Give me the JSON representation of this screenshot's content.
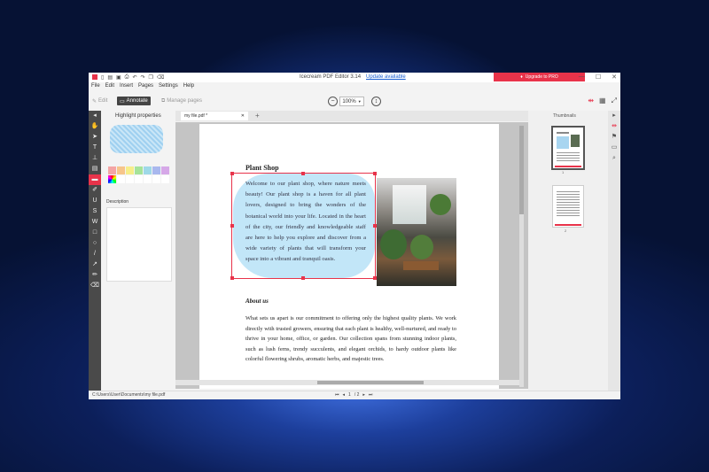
{
  "window": {
    "title": "Icecream PDF Editor 3.14",
    "update_link": "Update available",
    "upgrade_button": "Upgrade to PRO",
    "controls": [
      "—",
      "☐",
      "✕"
    ]
  },
  "menu": [
    "File",
    "Edit",
    "Insert",
    "Pages",
    "Settings",
    "Help"
  ],
  "toolbar": {
    "modes": [
      "Edit",
      "Annotate",
      "Manage pages"
    ],
    "active_mode": "Annotate",
    "zoom": "100%"
  },
  "props_panel": {
    "title": "Highlight properties",
    "description_label": "Description",
    "colors": [
      "#f4a5a5",
      "#f7c58a",
      "#f6ee8a",
      "#a6e39a",
      "#9fd9e8",
      "#a9b8ee",
      "#d6a8e8",
      "#ffffff"
    ]
  },
  "tabs": [
    {
      "label": "my file.pdf *"
    }
  ],
  "document": {
    "heading": "Plant Shop",
    "paragraph1": "Welcome to our plant shop, where nature meets beauty! Our plant shop is a haven for all plant lovers, designed to bring the wonders of the botanical world into your life. Located in the heart of the city, our friendly and knowledgeable staff are here to help you explore and discover from a wide variety of plants that will transform your space into a vibrant and tranquil oasis.",
    "subheading": "About us",
    "paragraph2": "What sets us apart is our commitment to offering only the highest quality plants. We work directly with trusted growers, ensuring that each plant is healthy, well-nurtured, and ready to thrive in your home, office, or garden. Our collection spans from stunning indoor plants, such as lush ferns, trendy succulents, and elegant orchids, to hardy outdoor plants like colorful flowering shrubs, aromatic herbs, and majestic trees."
  },
  "thumbnails": {
    "title": "Thumbnails",
    "pages": [
      "1",
      "2"
    ]
  },
  "status": {
    "path": "C:\\Users\\User\\Documents\\my file.pdf",
    "page_current": "1",
    "page_total": "/ 2"
  },
  "colors": {
    "accent": "#e8334a",
    "highlight": "#9fd0f0"
  }
}
